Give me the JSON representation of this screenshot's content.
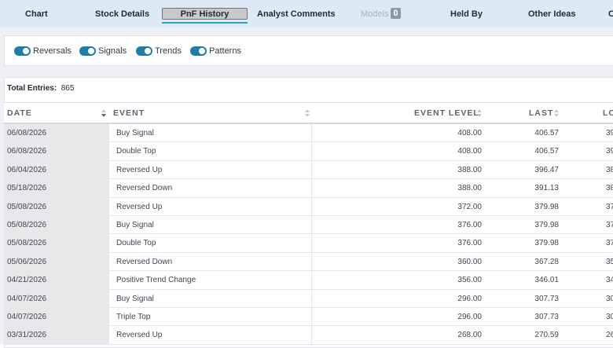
{
  "tabs": [
    {
      "label": "Chart"
    },
    {
      "label": "Stock Details"
    },
    {
      "label": "PnF History"
    },
    {
      "label": "Analyst Comments"
    },
    {
      "label": "Models",
      "badge": "0"
    },
    {
      "label": "Held By"
    },
    {
      "label": "Other Ideas"
    },
    {
      "label": "C"
    }
  ],
  "active_tab": "PnF History",
  "toggles": [
    {
      "label": "Reversals",
      "on": true
    },
    {
      "label": "Signals",
      "on": true
    },
    {
      "label": "Trends",
      "on": true
    },
    {
      "label": "Patterns",
      "on": true
    }
  ],
  "table": {
    "total_label": "Total Entries:",
    "total_value": "865",
    "columns": {
      "date": "DATE",
      "event": "EVENT",
      "event_level": "EVENT LEVEL",
      "last": "LAST",
      "low": "LO"
    },
    "rows": [
      {
        "date": "06/08/2026",
        "event": "Buy Signal",
        "level": "408.00",
        "last": "406.57",
        "low": "39"
      },
      {
        "date": "06/08/2026",
        "event": "Double Top",
        "level": "408.00",
        "last": "406.57",
        "low": "39"
      },
      {
        "date": "06/04/2026",
        "event": "Reversed Up",
        "level": "388.00",
        "last": "396.47",
        "low": "38"
      },
      {
        "date": "05/18/2026",
        "event": "Reversed Down",
        "level": "388.00",
        "last": "391.13",
        "low": "38"
      },
      {
        "date": "05/08/2026",
        "event": "Reversed Up",
        "level": "372.00",
        "last": "379.98",
        "low": "37"
      },
      {
        "date": "05/08/2026",
        "event": "Buy Signal",
        "level": "376.00",
        "last": "379.98",
        "low": "37"
      },
      {
        "date": "05/08/2026",
        "event": "Double Top",
        "level": "376.00",
        "last": "379.98",
        "low": "37"
      },
      {
        "date": "05/06/2026",
        "event": "Reversed Down",
        "level": "360.00",
        "last": "367.28",
        "low": "35"
      },
      {
        "date": "04/21/2026",
        "event": "Positive Trend Change",
        "level": "356.00",
        "last": "346.01",
        "low": "34"
      },
      {
        "date": "04/07/2026",
        "event": "Buy Signal",
        "level": "296.00",
        "last": "307.73",
        "low": "30"
      },
      {
        "date": "04/07/2026",
        "event": "Triple Top",
        "level": "296.00",
        "last": "307.73",
        "low": "30"
      },
      {
        "date": "03/31/2026",
        "event": "Reversed Up",
        "level": "268.00",
        "last": "270.59",
        "low": "26"
      }
    ]
  },
  "icons": {
    "sort": "sort-arrows-icon",
    "toggle": "toggle-switch-icon"
  },
  "colors": {
    "tab_bar": "#dde9f5",
    "active_underline": "#2aa6b3",
    "toggle_on": "#1f7ea8"
  }
}
